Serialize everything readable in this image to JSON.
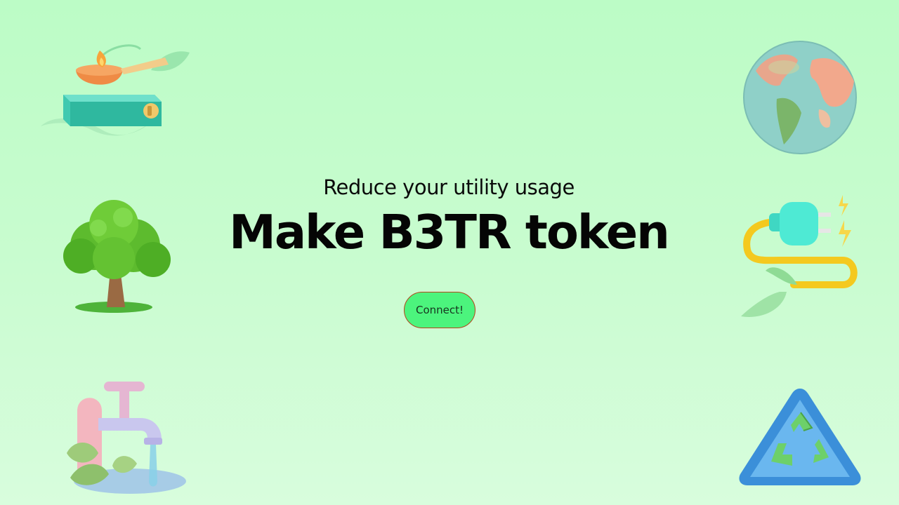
{
  "hero": {
    "subtitle": "Reduce your utility usage",
    "title": "Make B3TR token",
    "connect_label": "Connect!"
  },
  "colors": {
    "background_top": "#bcfcc6",
    "background_bottom": "#d8fddd",
    "button_fill": "#4cf47d",
    "button_border": "#b5451b"
  },
  "illustrations": [
    "stove-icon",
    "globe-icon",
    "tree-icon",
    "eco-plug-icon",
    "water-tap-icon",
    "recycle-icon"
  ]
}
